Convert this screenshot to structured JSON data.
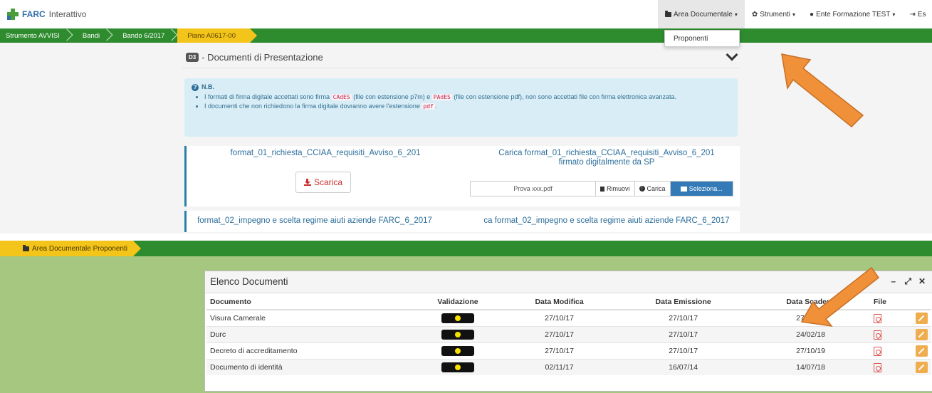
{
  "navbar": {
    "brand_main": "FARC",
    "brand_sub": "Interattivo",
    "menu": [
      {
        "label": "Area Documentale",
        "icon": "folder-icon"
      },
      {
        "label": "Strumenti",
        "icon": "gear-icon"
      },
      {
        "label": "Ente Formazione TEST",
        "icon": "user-icon"
      },
      {
        "label": "Es",
        "icon": "logout-icon"
      }
    ],
    "dropdown_item": "Proponenti"
  },
  "breadcrumb": [
    "Strumento AVVISI",
    "Bandi",
    "Bando 6/2017",
    "Piano A0617-00"
  ],
  "section": {
    "badge": "D3",
    "title": "- Documenti di Presentazione"
  },
  "info": {
    "nb": "N.B.",
    "line1_a": "I formati di firma digitale accettati sono firma",
    "code1": "CAdES",
    "line1_b": "(file con estensione p7m) e",
    "code2": "PAdES",
    "line1_c": "(file con estensione pdf), non sono accettati file con firma elettronica avanzata.",
    "line2_a": "I documenti che non richiedono la firma digitale dovranno avere l'estensione",
    "code3": "pdf",
    "line2_b": "."
  },
  "documents": [
    {
      "left": "format_01_richiesta_CCIAA_requisiti_Avviso_6_201",
      "right_1": "Carica format_01_richiesta_CCIAA_requisiti_Avviso_6_201",
      "right_2": "firmato digitalmente da SP",
      "download": "Scarica",
      "file": "Prova xxx.pdf",
      "remove": "Rimuovi",
      "upload": "Carica",
      "select": "Seleziona..."
    },
    {
      "left": "format_02_impegno e scelta regime aiuti aziende FARC_6_2017",
      "right_1": "ca format_02_impegno e scelta regime aiuti aziende FARC_6_2017"
    }
  ],
  "lower": {
    "crumb": "Area Documentale Proponenti",
    "widget_title": "Elenco Documenti",
    "columns": [
      "Documento",
      "Validazione",
      "Data Modifica",
      "Data Emissione",
      "Data Scadenz",
      "File",
      ""
    ],
    "rows": [
      {
        "doc": "Visura Camerale",
        "mod": "27/10/17",
        "em": "27/10/17",
        "sc": "27/04/18"
      },
      {
        "doc": "Durc",
        "mod": "27/10/17",
        "em": "27/10/17",
        "sc": "24/02/18"
      },
      {
        "doc": "Decreto di accreditamento",
        "mod": "27/10/17",
        "em": "27/10/17",
        "sc": "27/10/19"
      },
      {
        "doc": "Documento di identità",
        "mod": "02/11/17",
        "em": "16/07/14",
        "sc": "14/07/18"
      }
    ]
  },
  "colors": {
    "green_bar": "#2e8b2e",
    "crumb_yellow": "#f3c51a",
    "arrow_orange": "#f0913a",
    "lower_bg": "#a6c77f"
  }
}
